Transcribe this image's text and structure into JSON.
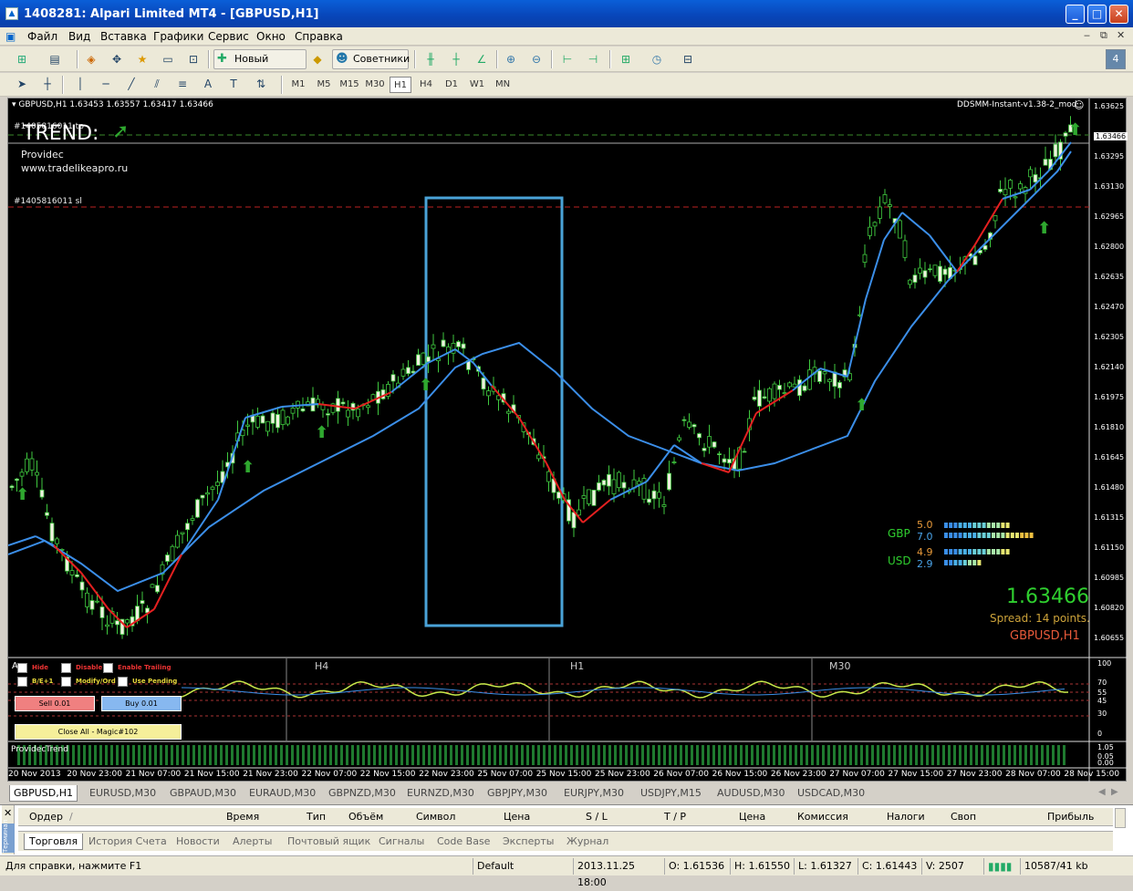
{
  "window": {
    "title": "1408281: Alpari Limited MT4 - [GBPUSD,H1]"
  },
  "menu": [
    "Файл",
    "Вид",
    "Вставка",
    "Графики",
    "Сервис",
    "Окно",
    "Справка"
  ],
  "toolbar": {
    "new_order": "Новый Ордер",
    "experts": "Советники",
    "badge": "4"
  },
  "timeframes": [
    "M1",
    "M5",
    "M15",
    "M30",
    "H1",
    "H4",
    "D1",
    "W1",
    "MN"
  ],
  "active_timeframe": "H1",
  "chart": {
    "header": "GBPUSD,H1  1.63453 1.63557 1.63417 1.63466",
    "indicator_name": "DDSMM-Instant-v1.38-2_mod",
    "trend_label": "TREND:",
    "ticket_tp": "#1405816011 tp",
    "ticket_sl": "#1405816011 sl",
    "provider": "Providec",
    "website": "www.tradelikeapro.ru",
    "price_levels": [
      "1.63625",
      "1.63466",
      "1.63295",
      "1.63130",
      "1.62965",
      "1.62800",
      "1.62635",
      "1.62470",
      "1.62305",
      "1.62140",
      "1.61975",
      "1.61810",
      "1.61645",
      "1.61480",
      "1.61315",
      "1.61150",
      "1.60985",
      "1.60820",
      "1.60655"
    ],
    "current_price": "1.63466",
    "spread": "Spread: 14 points.",
    "symbol_tf": "GBPUSD,H1",
    "strength": [
      {
        "currency": "GBP",
        "v1": "5.0",
        "v2": "7.0"
      },
      {
        "currency": "USD",
        "v1": "4.9",
        "v2": "2.9"
      }
    ],
    "time_labels": [
      "20 Nov 2013",
      "20 Nov 23:00",
      "21 Nov 07:00",
      "21 Nov 15:00",
      "21 Nov 23:00",
      "22 Nov 07:00",
      "22 Nov 15:00",
      "22 Nov 23:00",
      "25 Nov 07:00",
      "25 Nov 15:00",
      "25 Nov 23:00",
      "26 Nov 07:00",
      "26 Nov 15:00",
      "26 Nov 23:00",
      "27 Nov 07:00",
      "27 Nov 15:00",
      "27 Nov 23:00",
      "28 Nov 07:00",
      "28 Nov 15:00"
    ]
  },
  "sub_panel": {
    "tf_labels": [
      "H4",
      "H1",
      "M30"
    ],
    "levels": [
      "100",
      "70",
      "55",
      "45",
      "30",
      "0"
    ],
    "hide": "Hide",
    "disable": "Disable",
    "enable_trailing": "Enable Trailing",
    "be": "B/E+1",
    "modify": "Modify/Ord",
    "use_pending": "Use Pending",
    "sell": "Sell 0.01",
    "buy": "Buy 0.01",
    "close_all": "Close All - Magic#102",
    "a_label": "A"
  },
  "providec_trend": {
    "label": "ProvidecTrend",
    "high": "1.05",
    "mid1": "0.05",
    "mid2": "0.00"
  },
  "chart_tabs": [
    "GBPUSD,H1",
    "EURUSD,M30",
    "GBPAUD,M30",
    "EURAUD,M30",
    "GBPNZD,M30",
    "EURNZD,M30",
    "GBPJPY,M30",
    "EURJPY,M30",
    "USDJPY,M15",
    "AUDUSD,M30",
    "USDCAD,M30"
  ],
  "terminal": {
    "columns": [
      "Ордер",
      "/",
      "Время",
      "Тип",
      "Объём",
      "Символ",
      "Цена",
      "S / L",
      "T / P",
      "Цена",
      "Комиссия",
      "Налоги",
      "Своп",
      "Прибыль"
    ],
    "tabs": [
      "Торговля",
      "История Счета",
      "Новости",
      "Алерты",
      "Почтовый ящик",
      "Сигналы",
      "Code Base",
      "Эксперты",
      "Журнал"
    ],
    "side_label": "Терминал"
  },
  "status": {
    "help": "Для справки, нажмите F1",
    "profile": "Default",
    "datetime": "2013.11.25 18:00",
    "open": "O: 1.61536",
    "high": "H: 1.61550",
    "low": "L: 1.61327",
    "close": "C: 1.61443",
    "volume": "V: 2507",
    "traffic": "10587/41 kb"
  }
}
